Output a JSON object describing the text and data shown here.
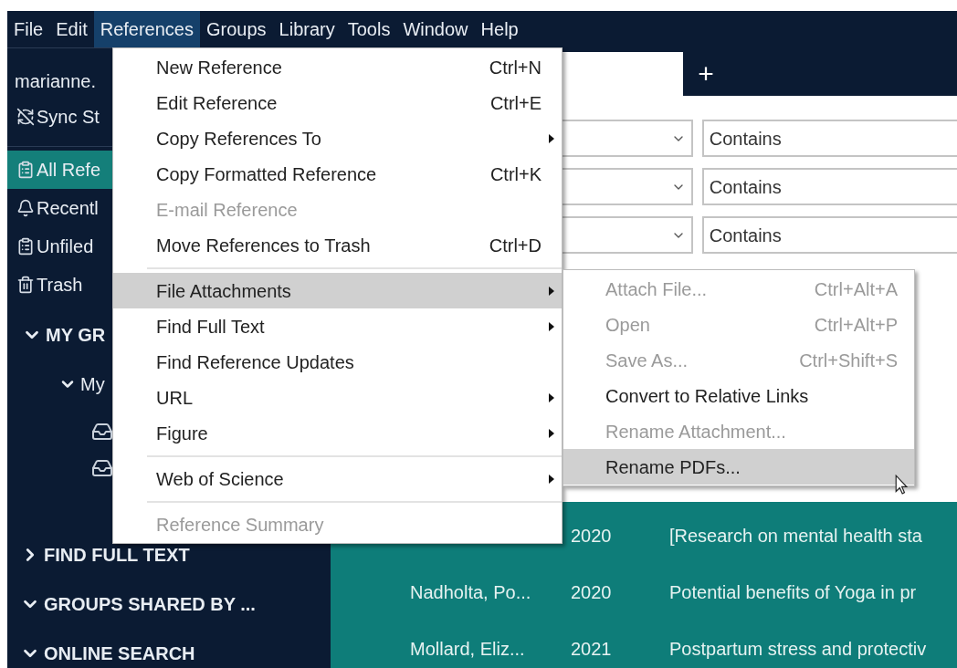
{
  "menu_bar": [
    {
      "label": "File",
      "selected": false
    },
    {
      "label": "Edit",
      "selected": false
    },
    {
      "label": "References",
      "selected": true
    },
    {
      "label": "Groups",
      "selected": false
    },
    {
      "label": "Library",
      "selected": false
    },
    {
      "label": "Tools",
      "selected": false
    },
    {
      "label": "Window",
      "selected": false
    },
    {
      "label": "Help",
      "selected": false
    }
  ],
  "sidebar": {
    "account": "marianne.",
    "sync_status": "Sync St",
    "items": [
      {
        "label": "All Refe",
        "kind": "clipboard",
        "selected": true
      },
      {
        "label": "Recentl",
        "kind": "bell",
        "selected": false
      },
      {
        "label": "Unfiled",
        "kind": "clipboard",
        "selected": false
      },
      {
        "label": "Trash",
        "kind": "trash",
        "selected": false
      }
    ],
    "my_groups": {
      "label": "MY GR",
      "expanded": true,
      "children": [
        {
          "label": "My",
          "expanded": true,
          "children": [
            {
              "kind": "group"
            },
            {
              "kind": "group"
            }
          ]
        }
      ]
    },
    "sections": [
      {
        "label": "FIND FULL TEXT",
        "expanded": false
      },
      {
        "label": "GROUPS SHARED BY ...",
        "expanded": true
      },
      {
        "label": "ONLINE SEARCH",
        "expanded": true
      }
    ]
  },
  "new_tab_button": "+",
  "search_rows": [
    {
      "operator": "Contains"
    },
    {
      "operator": "Contains"
    },
    {
      "operator": "Contains"
    }
  ],
  "references": [
    {
      "year": "2020",
      "title": "[Research on mental health sta"
    },
    {
      "author": "Nadholta, Po...",
      "year": "2020",
      "title": "Potential benefits of Yoga in pr"
    },
    {
      "author": "Mollard, Eliz...",
      "year": "2021",
      "title": "Postpartum stress and protectiv"
    }
  ],
  "references_menu": [
    {
      "kind": "item",
      "label": "New Reference",
      "shortcut": "Ctrl+N",
      "submenu": false,
      "disabled": false,
      "selected": false
    },
    {
      "kind": "item",
      "label": "Edit Reference",
      "shortcut": "Ctrl+E",
      "submenu": false,
      "disabled": false,
      "selected": false
    },
    {
      "kind": "item",
      "label": "Copy References To",
      "submenu": true,
      "disabled": false,
      "selected": false
    },
    {
      "kind": "item",
      "label": "Copy Formatted Reference",
      "shortcut": "Ctrl+K",
      "submenu": false,
      "disabled": false,
      "selected": false
    },
    {
      "kind": "item",
      "label": "E-mail Reference",
      "submenu": false,
      "disabled": true,
      "selected": false
    },
    {
      "kind": "item",
      "label": "Move References to Trash",
      "shortcut": "Ctrl+D",
      "submenu": false,
      "disabled": false,
      "selected": false
    },
    {
      "kind": "separator"
    },
    {
      "kind": "item",
      "label": "File Attachments",
      "submenu": true,
      "disabled": false,
      "selected": true
    },
    {
      "kind": "item",
      "label": "Find Full Text",
      "submenu": true,
      "disabled": false,
      "selected": false
    },
    {
      "kind": "item",
      "label": "Find Reference Updates",
      "submenu": false,
      "disabled": false,
      "selected": false
    },
    {
      "kind": "item",
      "label": "URL",
      "submenu": true,
      "disabled": false,
      "selected": false
    },
    {
      "kind": "item",
      "label": "Figure",
      "submenu": true,
      "disabled": false,
      "selected": false
    },
    {
      "kind": "separator"
    },
    {
      "kind": "item",
      "label": "Web of Science",
      "submenu": true,
      "disabled": false,
      "selected": false
    },
    {
      "kind": "separator"
    },
    {
      "kind": "item",
      "label": "Reference Summary",
      "submenu": false,
      "disabled": true,
      "selected": false
    }
  ],
  "file_attachments_submenu": [
    {
      "label": "Attach File...",
      "shortcut": "Ctrl+Alt+A",
      "disabled": true,
      "selected": false
    },
    {
      "label": "Open",
      "shortcut": "Ctrl+Alt+P",
      "disabled": true,
      "selected": false
    },
    {
      "label": "Save As...",
      "shortcut": "Ctrl+Shift+S",
      "disabled": true,
      "selected": false
    },
    {
      "label": "Convert to Relative Links",
      "disabled": false,
      "selected": false
    },
    {
      "label": "Rename Attachment...",
      "disabled": true,
      "selected": false
    },
    {
      "label": "Rename PDFs...",
      "disabled": false,
      "selected": true
    }
  ]
}
